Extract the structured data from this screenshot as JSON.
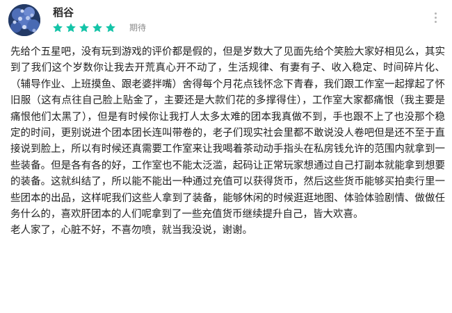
{
  "review": {
    "username": "稻谷",
    "rating": 5,
    "rating_max": 5,
    "period_label": "期待",
    "star_color": "#14c4a8",
    "body": "先给个五星吧，没有玩到游戏的评价都是假的，但是岁数大了见面先给个笑脸大家好相见么，其实到了我们这个岁数你让我去开荒真心开不动了，生活规律、有妻有子、收入稳定、时间碎片化、（辅导作业、上班摸鱼、跟老婆拌嘴）舍得每个月花点钱怀念下青春，我们跟工作室一起撑起了怀旧服（这有点往自己脸上贴金了，主要还是大款们花的多撑得住），工作室大家都痛恨（我主要是痛恨他们太黑了），但是有时候你让我打人太多太难的团本我真做不到，手也跟不上了也没那个稳定的时间，更别说进个团本团长连叫带卷的，老子们现实社会里都不敢说没人卷吧但是还不至于直接说到脸上，所以有时候还真需要工作室来让我喝着茶动动手指头在私房钱允许的范围内就拿到一些装备。但是各有各的好，工作室也不能太泛滥，起码让正常玩家想通过自己打副本就能拿到想要的装备。这就纠结了，所以能不能出一种通过充值可以获得货币，然后这些货币能够买拍卖行里一些团本的出品，这样呢我们这些人拿到了装备，能够休闲的时候逛逛地图、体验体验剧情、做做任务什么的，喜欢肝团本的人们呢拿到了一些充值货币继续提升自己，皆大欢喜。",
    "closing": "老人家了，心脏不好，不喜勿喷，就当我没说，谢谢。"
  }
}
